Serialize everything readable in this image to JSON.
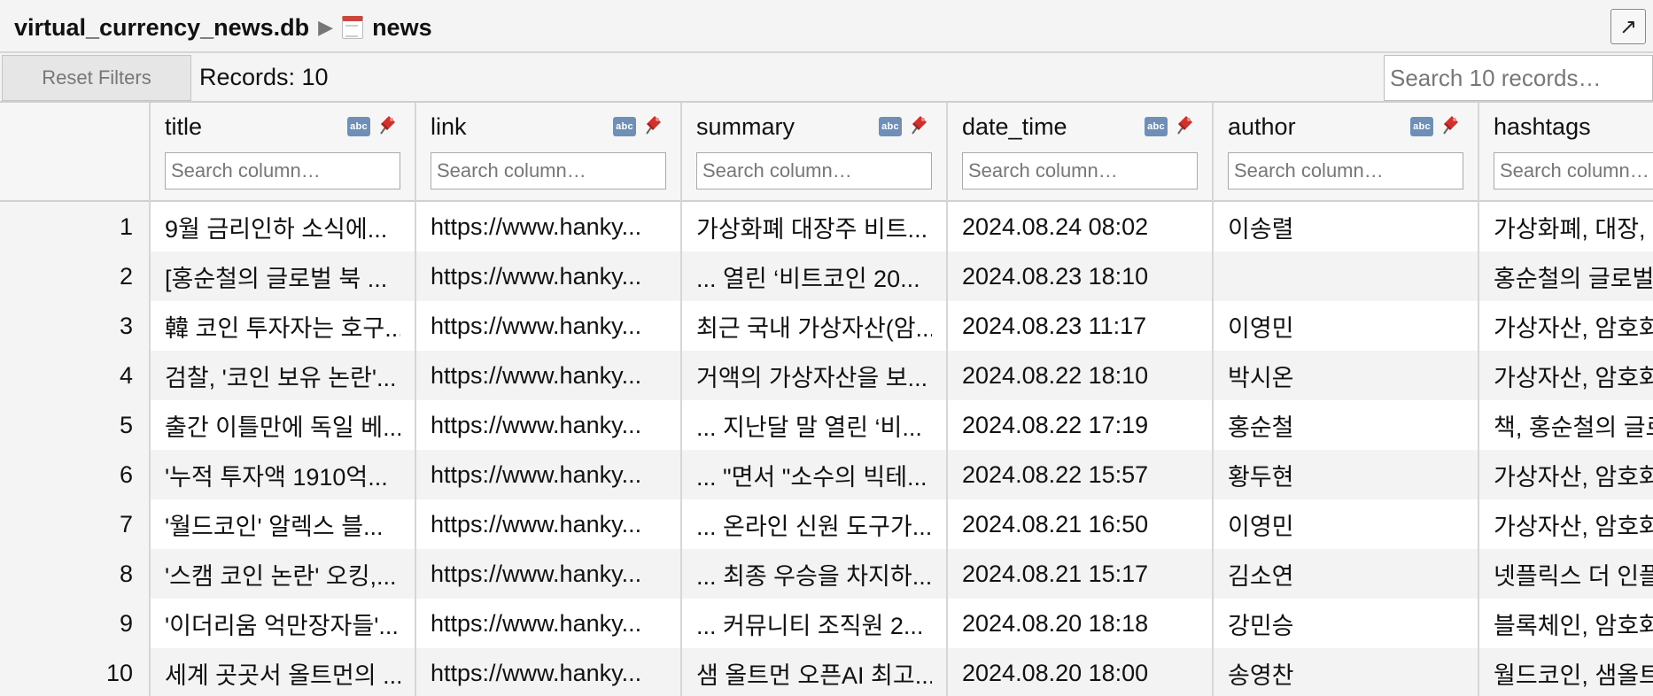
{
  "header": {
    "database": "virtual_currency_news.db",
    "separator": "▶",
    "table": "news",
    "expand_glyph": "↗"
  },
  "toolbar": {
    "reset_label": "Reset Filters",
    "records_label": "Records: 10",
    "search_placeholder": "Search 10 records…"
  },
  "columns": [
    {
      "name": "title",
      "search_placeholder": "Search column…"
    },
    {
      "name": "link",
      "search_placeholder": "Search column…"
    },
    {
      "name": "summary",
      "search_placeholder": "Search column…"
    },
    {
      "name": "date_time",
      "search_placeholder": "Search column…"
    },
    {
      "name": "author",
      "search_placeholder": "Search column…"
    },
    {
      "name": "hashtags",
      "search_placeholder": "Search column…"
    }
  ],
  "type_badge": "abc",
  "rows": [
    {
      "num": "1",
      "cells": [
        "9월 금리인하 소식에...",
        "https://www.hanky...",
        "가상화폐 대장주 비트...",
        "2024.08.24 08:02",
        "이송렬",
        "가상화폐, 대장,"
      ]
    },
    {
      "num": "2",
      "cells": [
        "[홍순철의 글로벌 북 ...",
        "https://www.hanky...",
        "... 열린 ‘비트코인 20...",
        "2024.08.23 18:10",
        "",
        "홍순철의 글로벌"
      ]
    },
    {
      "num": "3",
      "cells": [
        "韓 코인 투자자는 호구...",
        "https://www.hanky...",
        "최근 국내 가상자산(암...",
        "2024.08.23 11:17",
        "이영민",
        "가상자산, 암호화"
      ]
    },
    {
      "num": "4",
      "cells": [
        "검찰, '코인 보유 논란'...",
        "https://www.hanky...",
        "거액의 가상자산을 보...",
        "2024.08.22 18:10",
        "박시온",
        "가상자산, 암호화"
      ]
    },
    {
      "num": "5",
      "cells": [
        "출간 이틀만에 독일 베...",
        "https://www.hanky...",
        "... 지난달 말 열린 ‘비...",
        "2024.08.22 17:19",
        "홍순철",
        "책, 홍순철의 글로"
      ]
    },
    {
      "num": "6",
      "cells": [
        "'누적 투자액 1910억...",
        "https://www.hanky...",
        "... \"면서 \"소수의 빅테...",
        "2024.08.22 15:57",
        "황두현",
        "가상자산, 암호화"
      ]
    },
    {
      "num": "7",
      "cells": [
        "'월드코인' 알렉스 블...",
        "https://www.hanky...",
        "... 온라인 신원 도구가...",
        "2024.08.21 16:50",
        "이영민",
        "가상자산, 암호화"
      ]
    },
    {
      "num": "8",
      "cells": [
        "'스캠 코인 논란' 오킹,...",
        "https://www.hanky...",
        "... 최종 우승을 차지하...",
        "2024.08.21 15:17",
        "김소연",
        "넷플릭스 더 인플"
      ]
    },
    {
      "num": "9",
      "cells": [
        "'이더리움 억만장자들'...",
        "https://www.hanky...",
        "... 커뮤니티 조직원 2...",
        "2024.08.20 18:18",
        "강민승",
        "블록체인, 암호화"
      ]
    },
    {
      "num": "10",
      "cells": [
        "세계 곳곳서 올트먼의 ...",
        "https://www.hanky...",
        "샘 올트먼 오픈AI 최고...",
        "2024.08.20 18:00",
        "송영찬",
        "월드코인, 샘올트"
      ]
    }
  ],
  "colors": {
    "header_bg": "#f4f4f4",
    "row_alt_bg": "#f3f3f3",
    "badge_bg": "#6f8fb6",
    "pin_red": "#d0312d"
  }
}
